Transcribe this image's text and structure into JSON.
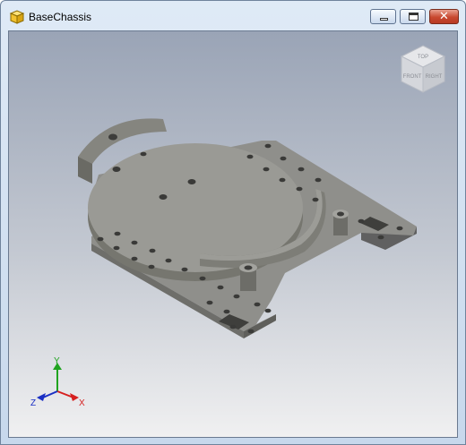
{
  "window": {
    "title": "BaseChassis",
    "buttons": {
      "minimize": "minimize",
      "maximize": "maximize",
      "close": "close"
    }
  },
  "view_cube": {
    "faces": [
      "TOP",
      "FRONT",
      "RIGHT"
    ]
  },
  "axes": {
    "x": "X",
    "y": "Y",
    "z": "Z"
  },
  "colors": {
    "x_axis": "#d62020",
    "y_axis": "#1fa31f",
    "z_axis": "#1a2fc4",
    "part": "#8f8f8b"
  }
}
